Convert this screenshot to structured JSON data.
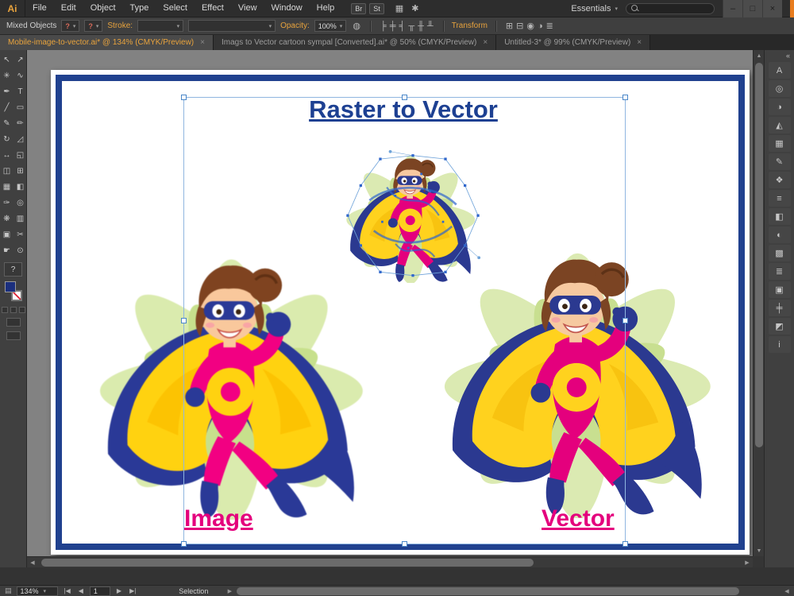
{
  "menubar": {
    "logo": "Ai",
    "items": [
      "File",
      "Edit",
      "Object",
      "Type",
      "Select",
      "Effect",
      "View",
      "Window",
      "Help"
    ],
    "quick_buttons": [
      {
        "name": "bridge-button",
        "label": "Br"
      },
      {
        "name": "stock-photos-button",
        "label": "St"
      }
    ],
    "icons": [
      {
        "name": "arrange-documents-icon",
        "glyph": "▦"
      },
      {
        "name": "cs-live-icon",
        "glyph": "✱"
      }
    ],
    "workspace_label": "Essentials",
    "dropdown_arrow": "▾",
    "search_placeholder": "",
    "window_controls": [
      {
        "name": "minimize-button",
        "glyph": "–"
      },
      {
        "name": "maximize-button",
        "glyph": "□"
      },
      {
        "name": "close-button",
        "glyph": "×"
      }
    ]
  },
  "control_bar": {
    "selection_type": "Mixed Objects",
    "variable_combo_icon": "?",
    "stroke_label": "Stroke:",
    "opacity_label": "Opacity:",
    "opacity_value": "100%",
    "transform_label": "Transform",
    "align_icons": [
      {
        "name": "align-horizontal-left-icon",
        "glyph": "╞"
      },
      {
        "name": "align-horizontal-center-icon",
        "glyph": "╪"
      },
      {
        "name": "align-horizontal-right-icon",
        "glyph": "╡"
      },
      {
        "name": "align-vertical-top-icon",
        "glyph": "╥"
      },
      {
        "name": "align-vertical-center-icon",
        "glyph": "╫"
      },
      {
        "name": "align-vertical-bottom-icon",
        "glyph": "╨"
      }
    ],
    "extra_icons": [
      {
        "name": "shape-mode-unite-icon",
        "glyph": "⊞"
      },
      {
        "name": "shape-mode-minus-icon",
        "glyph": "⊟"
      },
      {
        "name": "isolate-selected-object-icon",
        "glyph": "◉"
      },
      {
        "name": "recolor-artwork-icon",
        "glyph": "◑"
      },
      {
        "name": "panel-menu-icon",
        "glyph": "≣"
      }
    ]
  },
  "tabs": [
    {
      "label": "Mobile-image-to-vector.ai* @ 134% (CMYK/Preview)",
      "close": "×",
      "active": true
    },
    {
      "label": "Imags to Vector cartoon sympal [Converted].ai* @ 50% (CMYK/Preview)",
      "close": "×",
      "active": false
    },
    {
      "label": "Untitled-3* @ 99% (CMYK/Preview)",
      "close": "×",
      "active": false
    }
  ],
  "tool_panel": {
    "tools": [
      {
        "name": "selection-tool",
        "glyph": "↖"
      },
      {
        "name": "direct-selection-tool",
        "glyph": "↗"
      },
      {
        "name": "magic-wand-tool",
        "glyph": "✳"
      },
      {
        "name": "lasso-tool",
        "glyph": "∿"
      },
      {
        "name": "pen-tool",
        "glyph": "✒"
      },
      {
        "name": "type-tool",
        "glyph": "T"
      },
      {
        "name": "line-segment-tool",
        "glyph": "╱"
      },
      {
        "name": "rectangle-tool",
        "glyph": "▭"
      },
      {
        "name": "paintbrush-tool",
        "glyph": "✎"
      },
      {
        "name": "pencil-tool",
        "glyph": "✏"
      },
      {
        "name": "rotate-tool",
        "glyph": "↻"
      },
      {
        "name": "scale-tool",
        "glyph": "◿"
      },
      {
        "name": "width-tool",
        "glyph": "↔"
      },
      {
        "name": "free-transform-tool",
        "glyph": "◱"
      },
      {
        "name": "shape-builder-tool",
        "glyph": "◫"
      },
      {
        "name": "perspective-grid-tool",
        "glyph": "⊞"
      },
      {
        "name": "mesh-tool",
        "glyph": "▦"
      },
      {
        "name": "gradient-tool",
        "glyph": "◧"
      },
      {
        "name": "eyedropper-tool",
        "glyph": "✑"
      },
      {
        "name": "blend-tool",
        "glyph": "◎"
      },
      {
        "name": "symbol-sprayer-tool",
        "glyph": "❋"
      },
      {
        "name": "column-graph-tool",
        "glyph": "▥"
      },
      {
        "name": "artboard-tool",
        "glyph": "▣"
      },
      {
        "name": "slice-tool",
        "glyph": "✂"
      },
      {
        "name": "hand-tool",
        "glyph": "☛"
      },
      {
        "name": "zoom-tool",
        "glyph": "⊙"
      }
    ],
    "help_label": "?",
    "fill_color": "#1b2f7e"
  },
  "right_dock": {
    "collapse_icon": "«",
    "panels": [
      {
        "name": "character-panel-icon",
        "glyph": "A"
      },
      {
        "name": "appearance-panel-icon",
        "glyph": "◎"
      },
      {
        "name": "color-panel-icon",
        "glyph": "◑"
      },
      {
        "name": "color-guide-panel-icon",
        "glyph": "◭"
      },
      {
        "name": "swatches-panel-icon",
        "glyph": "▦"
      },
      {
        "name": "brushes-panel-icon",
        "glyph": "✎"
      },
      {
        "name": "symbols-panel-icon",
        "glyph": "❖"
      },
      {
        "name": "stroke-panel-icon",
        "glyph": "≡"
      },
      {
        "name": "gradient-panel-icon",
        "glyph": "◧"
      },
      {
        "name": "transparency-panel-icon",
        "glyph": "◐"
      },
      {
        "name": "graphic-styles-panel-icon",
        "glyph": "▩"
      },
      {
        "name": "layers-panel-icon",
        "glyph": "≣"
      },
      {
        "name": "artboards-panel-icon",
        "glyph": "▣"
      },
      {
        "name": "align-panel-icon",
        "glyph": "╪"
      },
      {
        "name": "pathfinder-panel-icon",
        "glyph": "◩"
      },
      {
        "name": "info-panel-icon",
        "glyph": "i"
      }
    ]
  },
  "artboard": {
    "title": "Raster to Vector",
    "image_label": "Image",
    "vector_label": "Vector"
  },
  "status_bar": {
    "zoom": "134%",
    "zoom_arrow": "▾",
    "nav_first": "|◀",
    "nav_prev": "◀",
    "artboard_number": "1",
    "nav_next": "▶",
    "nav_last": "▶|",
    "status": "Selection"
  },
  "colors": {
    "accent_orange": "#e8a33d",
    "label_magenta": "#e4007d",
    "title_blue": "#1d4092",
    "selection_blue": "#8fb6e0",
    "cape_yellow": "#ffd21e",
    "suit_magenta": "#e4007d",
    "cape_blue": "#2b3990",
    "swirl_green": "#cde09a"
  }
}
